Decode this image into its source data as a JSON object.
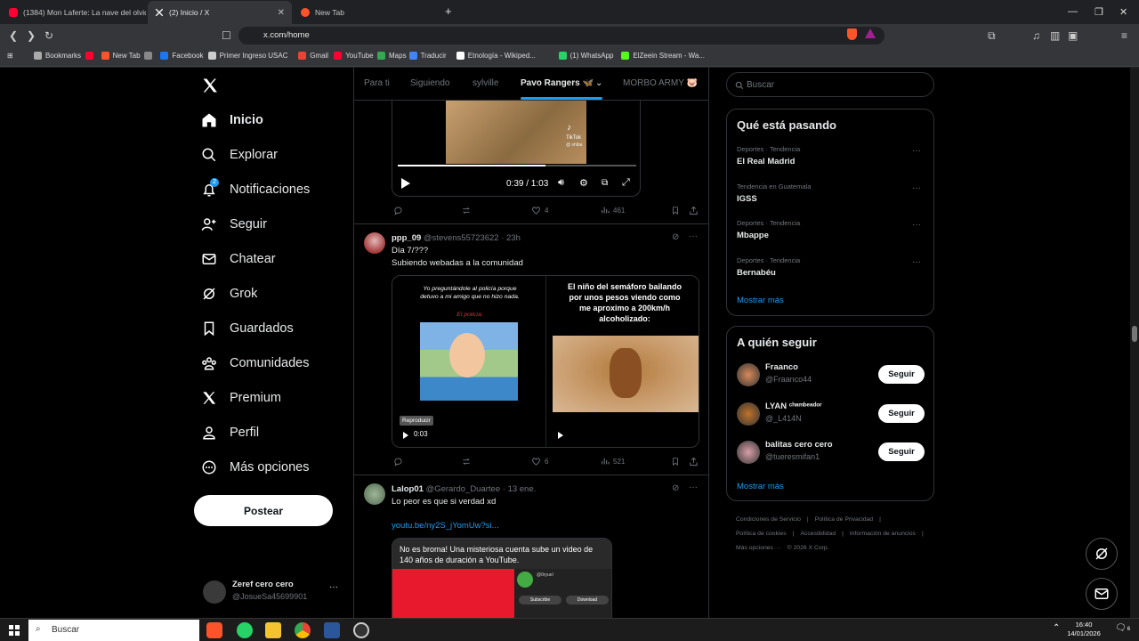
{
  "browser": {
    "tabs": [
      {
        "title": "(1384) Mon Laferte: La nave del olvid...",
        "color": "#ff0033"
      },
      {
        "title": "(2) Inicio / X",
        "color": "#ffffff"
      },
      {
        "title": "New Tab",
        "color": "#fb542b"
      }
    ],
    "new_tab": "+",
    "url": "x.com/home",
    "bookmarks": [
      {
        "label": "Bookmarks",
        "color": "#aaaaaa"
      },
      {
        "label": "",
        "color": "#ff0033"
      },
      {
        "label": "New Tab",
        "color": "#fb542b"
      },
      {
        "label": "",
        "color": "#888888"
      },
      {
        "label": "Facebook",
        "color": "#1877f2"
      },
      {
        "label": "Primer Ingreso USAC",
        "color": "#cccccc"
      },
      {
        "label": "Gmail",
        "color": "#ea4335"
      },
      {
        "label": "YouTube",
        "color": "#ff0033"
      },
      {
        "label": "Maps",
        "color": "#34a853"
      },
      {
        "label": "Traducir",
        "color": "#4285f4"
      },
      {
        "label": "Etnología - Wikiped...",
        "color": "#ffffff"
      },
      {
        "label": "(1) WhatsApp",
        "color": "#25d366"
      },
      {
        "label": "ElZeein Stream - Wa...",
        "color": "#53fc18"
      }
    ]
  },
  "nav": {
    "items": [
      {
        "label": "Inicio",
        "icon": "home-icon"
      },
      {
        "label": "Explorar",
        "icon": "search-icon"
      },
      {
        "label": "Notificaciones",
        "icon": "bell-icon",
        "badge": "2"
      },
      {
        "label": "Seguir",
        "icon": "add-person-icon"
      },
      {
        "label": "Chatear",
        "icon": "mail-icon"
      },
      {
        "label": "Grok",
        "icon": "grok-icon"
      },
      {
        "label": "Guardados",
        "icon": "bookmark-icon"
      },
      {
        "label": "Comunidades",
        "icon": "communities-icon"
      },
      {
        "label": "Premium",
        "icon": "x-icon"
      },
      {
        "label": "Perfil",
        "icon": "person-icon"
      },
      {
        "label": "Más opciones",
        "icon": "more-circle-icon"
      }
    ],
    "post_button": "Postear",
    "me": {
      "name": "Zeref cero cero",
      "handle": "@JosueSa45699901",
      "more": "···"
    }
  },
  "feed": {
    "tabs": [
      "Para ti",
      "Siguiendo",
      "sylville",
      "Pavo Rangers 🦋",
      "MORBO ARMY 🐷"
    ],
    "post0": {
      "video_time": "0:39 / 1:03",
      "tiktok_label": "TikTok",
      "tiktok_handle": "@ shiba",
      "replies": "",
      "reposts": "",
      "likes": "4",
      "views": "461",
      "progress": 0.62
    },
    "post1": {
      "name": "ppp_09",
      "handle": "@stevens55723622",
      "time": "· 23h",
      "text1": "Día 7/???",
      "text2": "Subiendo webadas a la comunidad",
      "left_caption": "Yo preguntándole al policía porque detuvo a mi amigo que no hizo nada.",
      "left_sub": "El policía:",
      "right_caption": "El niño del semáforo bailando por unos pesos viendo como me aproximo a 200km/h alcoholizado:",
      "tooltip": "Reproducir",
      "video_time": "0:03",
      "likes": "6",
      "views": "521"
    },
    "post2": {
      "name": "Lalop01",
      "handle": "@Gerardo_Duartee",
      "time": "· 13 ene.",
      "text": "Lo peor es que si verdad xd",
      "link": "youtu.be/ny2S_jYomUw?si...",
      "card_text": "No es broma! Una misteriosa cuenta sube un video de 140 años de duración a YouTube.",
      "card_channel": "@0ryuel",
      "card_subscribe": "Subscribe",
      "card_download": "Download"
    }
  },
  "right": {
    "search_placeholder": "Buscar",
    "trends_title": "Qué está pasando",
    "trends": [
      {
        "cat": "Deportes · Tendencia",
        "name": "El Real Madrid"
      },
      {
        "cat": "Tendencia en Guatemala",
        "name": "IGSS"
      },
      {
        "cat": "Deportes · Tendencia",
        "name": "Mbappe"
      },
      {
        "cat": "Deportes · Tendencia",
        "name": "Bernabéu"
      }
    ],
    "show_more": "Mostrar más",
    "follow_title": "A quién seguir",
    "follow": [
      {
        "name": "Fraanco",
        "handle": "@Fraanco44",
        "btn": "Seguir",
        "color": "#d98a5a"
      },
      {
        "name": "LYAN ᶜʰᵃᵐᵇᵉᵃᵈᵒʳ",
        "handle": "@_L414N",
        "btn": "Seguir",
        "color": "#c0722a"
      },
      {
        "name": "balitas cero cero",
        "handle": "@tueresmifan1",
        "btn": "Seguir",
        "color": "#d9a0a8"
      }
    ],
    "follow_more": "Mostrar más",
    "footer": [
      "Condiciones de Servicio",
      "|",
      "Política de Privacidad",
      "|",
      "Política de cookies",
      "|",
      "Accesibilidad",
      "|",
      "Información de anuncios",
      "|",
      "Más opciones ···",
      "© 2026 X Corp."
    ]
  },
  "taskbar": {
    "search": "Buscar",
    "time": "16:40",
    "date": "14/01/2026",
    "notif": "6"
  }
}
